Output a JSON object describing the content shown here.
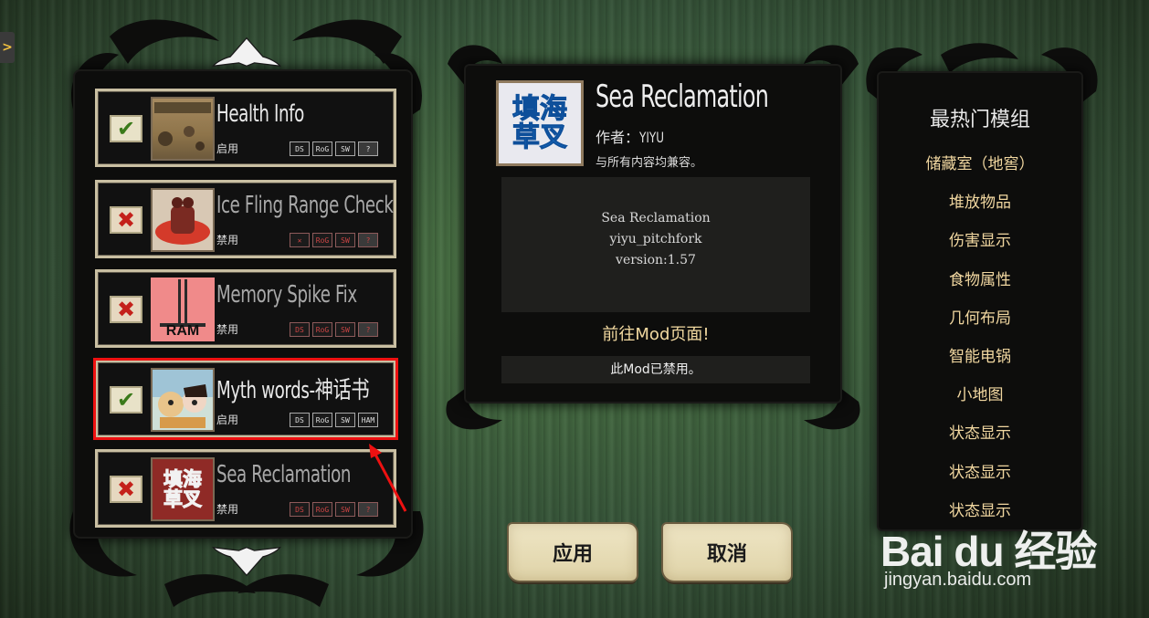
{
  "side_tab": {
    "glyph": ">"
  },
  "mods": [
    {
      "name": "Health Info",
      "status": "启用",
      "enabled": true,
      "check_glyph": "✔",
      "thumb": "health-info-thumbnail",
      "tags": [
        "DS",
        "RoG",
        "SW",
        "?"
      ]
    },
    {
      "name": "Ice Fling Range Check",
      "status": "禁用",
      "enabled": false,
      "check_glyph": "✖",
      "thumb": "ice-fling-thumbnail",
      "tags": [
        "✕",
        "RoG",
        "SW",
        "?"
      ]
    },
    {
      "name": "Memory Spike Fix",
      "status": "禁用",
      "enabled": false,
      "check_glyph": "✖",
      "thumb": "ram-thumbnail",
      "thumb_text": "RAM",
      "tags": [
        "DS",
        "RoG",
        "SW",
        "?"
      ]
    },
    {
      "name": "Myth words-神话书",
      "status": "启用",
      "enabled": true,
      "check_glyph": "✔",
      "thumb": "myth-words-thumbnail",
      "tags": [
        "DS",
        "RoG",
        "SW",
        "HAM"
      ]
    },
    {
      "name": "Sea Reclamation",
      "status": "禁用",
      "enabled": false,
      "check_glyph": "✖",
      "thumb": "sea-reclamation-thumbnail",
      "thumb_text": "填海草叉",
      "tags": [
        "DS",
        "RoG",
        "SW",
        "?"
      ]
    }
  ],
  "detail": {
    "icon_text": "填海草叉",
    "title": "Sea Reclamation",
    "author_label": "作者：",
    "author": "YIYU",
    "compat": "与所有内容均兼容。",
    "desc_lines": [
      "Sea Reclamation",
      "yiyu_pitchfork",
      "version:1.57"
    ],
    "link": "前往Mod页面!",
    "state": "此Mod已禁用。"
  },
  "buttons": {
    "apply": "应用",
    "cancel": "取消"
  },
  "popular": {
    "title": "最热门模组",
    "items": [
      "储藏室（地窖）",
      "堆放物品",
      "伤害显示",
      "食物属性",
      "几何布局",
      "智能电锅",
      "小地图",
      "状态显示",
      "状态显示",
      "状态显示"
    ]
  },
  "watermark": {
    "logo": "Bai du 经验",
    "url": "jingyan.baidu.com"
  },
  "colors": {
    "accent_gold": "#f1d7a0",
    "selection_red": "#e11111",
    "check_green": "#3a7a1a",
    "cross_red": "#c4211b"
  }
}
